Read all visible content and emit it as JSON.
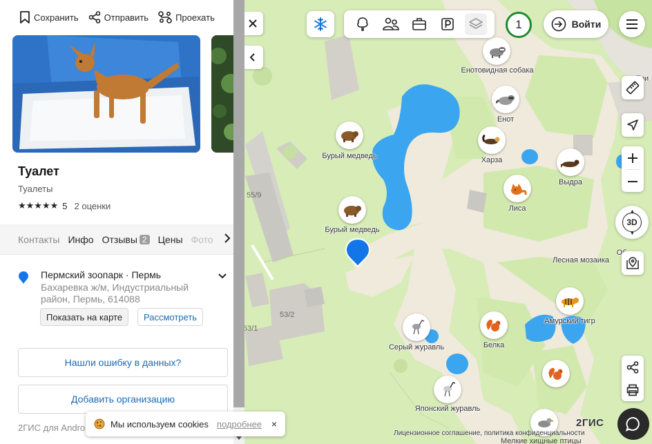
{
  "panel": {
    "actions": {
      "save": "Сохранить",
      "send": "Отправить",
      "route": "Проехать"
    },
    "title": "Туалет",
    "subtitle": "Туалеты",
    "rating": {
      "stars": "★★★★★",
      "value": "5",
      "count": "2 оценки"
    },
    "tabs": [
      {
        "label": "Контакты"
      },
      {
        "label": "Инфо"
      },
      {
        "label": "Отзывы",
        "badge": "2"
      },
      {
        "label": "Цены"
      },
      {
        "label": "Фото"
      }
    ],
    "address": {
      "line1": "Пермский зоопарк · Пермь",
      "line2": "Бахаревка ж/м, Индустриальный район, Пермь, 614088"
    },
    "show_on_map": "Показать на карте",
    "look": "Рассмотреть",
    "found_error": "Нашли ошибку в данных?",
    "add_org": "Добавить организацию",
    "footer": "2ГИС для Android"
  },
  "cookie": {
    "text": "Мы используем cookies",
    "more": "подробнее",
    "close": "×"
  },
  "map": {
    "floor": "1",
    "login": "Войти",
    "btn3d": "3D",
    "logo": "2ГИС",
    "license": "Лицензионное соглашение, политика конфиденциальности",
    "bottom_label": "Мелкие хищные птицы",
    "labels": {
      "raccoon_dog": "Енотовидная собака",
      "raccoon": "Енот",
      "brown_bear_1": "Бурый медведь",
      "kharza": "Харза",
      "otter": "Выдра",
      "fox": "Лиса",
      "brown_bear_2": "Бурый медведь",
      "forest_mosaic": "Лесная мозаика",
      "amur_tiger": "Амурский тигр",
      "grey_crane": "Серый журавль",
      "squirrel": "Белка",
      "japanese_crane": "Японский журавль",
      "ob_partial": "Об",
      "tri_partial": "Три"
    },
    "buildings": {
      "b1": "55/9",
      "b2": "53/2",
      "b3": "53/1"
    }
  }
}
